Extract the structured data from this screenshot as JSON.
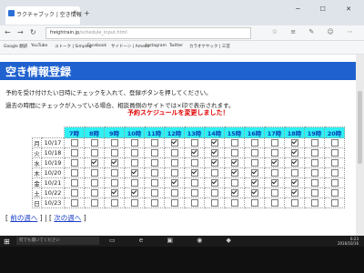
{
  "browser": {
    "tab_title": "ラクチャブック | 空き情報",
    "tab_close": "×",
    "new_tab": "+",
    "window_controls": "─ ☐ ✕",
    "back": "←",
    "forward": "→",
    "reload": "↻",
    "url_host": "freightrain.jp",
    "url_path": "/schedule_input.html",
    "nav_right": "☆ ≡ ✎ ☺ ⋯",
    "bookmarks": [
      "Google 翻訳",
      "YouTube",
      "ユトーク | Simplog",
      "Facebook",
      "サイドーン | Ameba",
      "Instagram",
      "Twitter",
      "カラオケヤック | 三宮"
    ]
  },
  "page": {
    "title": "空き情報登録",
    "instruction": "予約を受け付けたい日時にチェックを入れて、登録ボタンを押してください。",
    "note": "過去の時間にチェックが入っている場合、相談員側のサイトでは×印で表示されます。",
    "warning": "予約スケジュールを変更しました！",
    "hours": [
      "7時",
      "8時",
      "9時",
      "10時",
      "11時",
      "12時",
      "13時",
      "14時",
      "15時",
      "16時",
      "17時",
      "18時",
      "19時",
      "20時"
    ],
    "rows": [
      {
        "dow": "月",
        "date": "10/17",
        "checks": [
          0,
          0,
          0,
          0,
          0,
          1,
          0,
          1,
          0,
          0,
          0,
          1,
          0,
          0
        ]
      },
      {
        "dow": "火",
        "date": "10/18",
        "checks": [
          0,
          0,
          0,
          0,
          0,
          0,
          1,
          1,
          0,
          0,
          0,
          1,
          0,
          0
        ]
      },
      {
        "dow": "水",
        "date": "10/19",
        "checks": [
          0,
          1,
          1,
          0,
          0,
          0,
          0,
          1,
          1,
          0,
          1,
          1,
          0,
          0
        ]
      },
      {
        "dow": "木",
        "date": "10/20",
        "checks": [
          0,
          0,
          0,
          1,
          0,
          0,
          1,
          0,
          1,
          1,
          0,
          0,
          0,
          0
        ]
      },
      {
        "dow": "金",
        "date": "10/21",
        "checks": [
          0,
          0,
          0,
          0,
          0,
          1,
          0,
          1,
          0,
          1,
          1,
          1,
          0,
          0
        ]
      },
      {
        "dow": "土",
        "date": "10/22",
        "checks": [
          0,
          0,
          1,
          1,
          0,
          0,
          0,
          0,
          1,
          1,
          0,
          1,
          0,
          0
        ]
      },
      {
        "dow": "日",
        "date": "10/23",
        "checks": [
          0,
          0,
          0,
          0,
          0,
          0,
          0,
          0,
          0,
          0,
          0,
          0,
          0,
          0
        ]
      }
    ],
    "prev_label": "前の週へ",
    "next_label": "次の週へ",
    "bracket_open": "[",
    "bracket_close": "]",
    "separator": "|"
  },
  "taskbar": {
    "start_icon": "⊞",
    "search_placeholder": "何でも聞いてください",
    "icons": "▭ e ▣ ◉ ◆",
    "time": "6:23",
    "date": "2016/10/16"
  }
}
